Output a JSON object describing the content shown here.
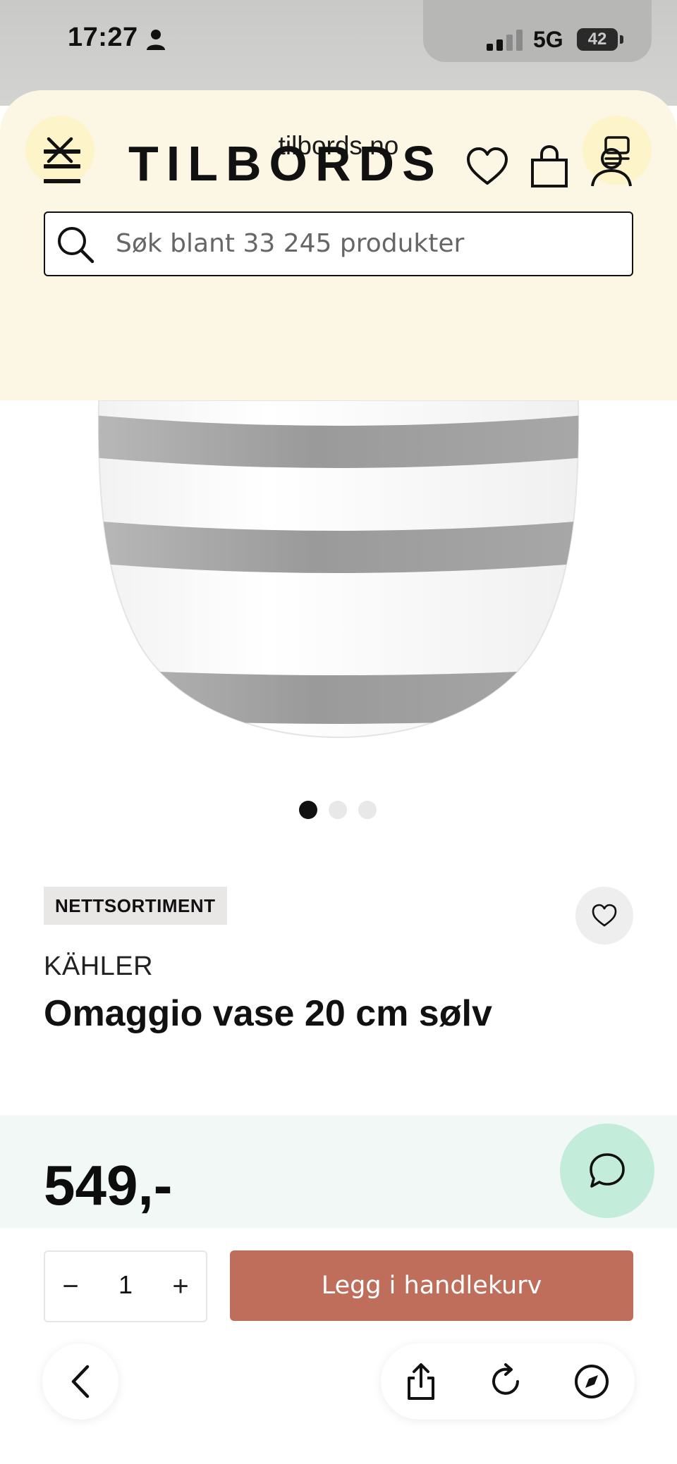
{
  "status_bar": {
    "time": "17:27",
    "network": "5G",
    "battery": "42"
  },
  "browser": {
    "url": "tilbords.no"
  },
  "site_header": {
    "logo": "TILBORDS",
    "search_placeholder": "Søk blant 33 245 produkter"
  },
  "gallery": {
    "total_images": 3,
    "active_index": 0
  },
  "product": {
    "badge": "NETTSORTIMENT",
    "brand": "KÄHLER",
    "title": "Omaggio vase 20 cm sølv",
    "price": "549,-"
  },
  "purchase": {
    "quantity": "1",
    "minus_label": "−",
    "plus_label": "+",
    "add_to_cart_label": "Legg i handlekurv"
  },
  "colors": {
    "header_bg": "#fcf7e4",
    "cart_button": "#c06e5c",
    "chat_button": "#c3ecdb",
    "price_band": "#f1f8f5"
  },
  "icons": {
    "status": [
      "person-icon",
      "signal-icon",
      "battery-icon"
    ],
    "browser": [
      "close-icon",
      "tabs-icon",
      "back-icon",
      "share-icon",
      "reload-icon",
      "compass-icon"
    ],
    "site": [
      "menu-icon",
      "heart-icon",
      "bag-icon",
      "user-icon",
      "search-icon",
      "chat-icon"
    ]
  }
}
